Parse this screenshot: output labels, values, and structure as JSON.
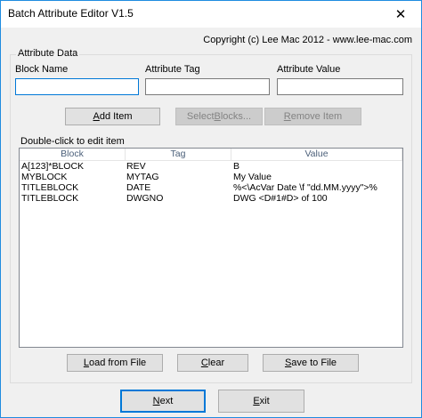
{
  "window": {
    "title": "Batch Attribute Editor V1.5",
    "close_glyph": "✕"
  },
  "copyright": "Copyright (c) Lee Mac 2012  -  www.lee-mac.com",
  "attribute_data": {
    "group_label": "Attribute Data",
    "block_name": {
      "label": "Block Name",
      "value": ""
    },
    "attribute_tag": {
      "label": "Attribute Tag",
      "value": ""
    },
    "attribute_value": {
      "label": "Attribute Value",
      "value": ""
    }
  },
  "buttons": {
    "add_item": {
      "pre": "",
      "mnemonic": "A",
      "post": "dd Item",
      "enabled": true
    },
    "select_blocks": {
      "pre": "Select ",
      "mnemonic": "B",
      "post": "locks...",
      "enabled": false
    },
    "remove_item": {
      "pre": "",
      "mnemonic": "R",
      "post": "emove Item",
      "enabled": false
    },
    "load_from_file": {
      "pre": "",
      "mnemonic": "L",
      "post": "oad from File",
      "enabled": true
    },
    "clear": {
      "pre": "",
      "mnemonic": "C",
      "post": "lear",
      "enabled": true
    },
    "save_to_file": {
      "pre": "",
      "mnemonic": "S",
      "post": "ave to File",
      "enabled": true
    },
    "next": {
      "pre": "",
      "mnemonic": "N",
      "post": "ext",
      "enabled": true
    },
    "exit": {
      "pre": "",
      "mnemonic": "E",
      "post": "xit",
      "enabled": true
    }
  },
  "list": {
    "hint": "Double-click to edit item",
    "columns": [
      "Block",
      "Tag",
      "Value"
    ],
    "rows": [
      {
        "block": "A[123]*BLOCK",
        "tag": "REV",
        "value": "B"
      },
      {
        "block": "MYBLOCK",
        "tag": "MYTAG",
        "value": "My Value"
      },
      {
        "block": "TITLEBLOCK",
        "tag": "DATE",
        "value": "%<\\AcVar Date \\f \"dd.MM.yyyy\">%"
      },
      {
        "block": "TITLEBLOCK",
        "tag": "DWGNO",
        "value": "DWG <D#1#D> of 100"
      }
    ]
  },
  "colors": {
    "window_border": "#1f8ce0",
    "dialog_bg": "#f0f0f0",
    "button_bg": "#e1e1e1",
    "default_button_border": "#0078d7",
    "disabled_text": "#838383"
  }
}
